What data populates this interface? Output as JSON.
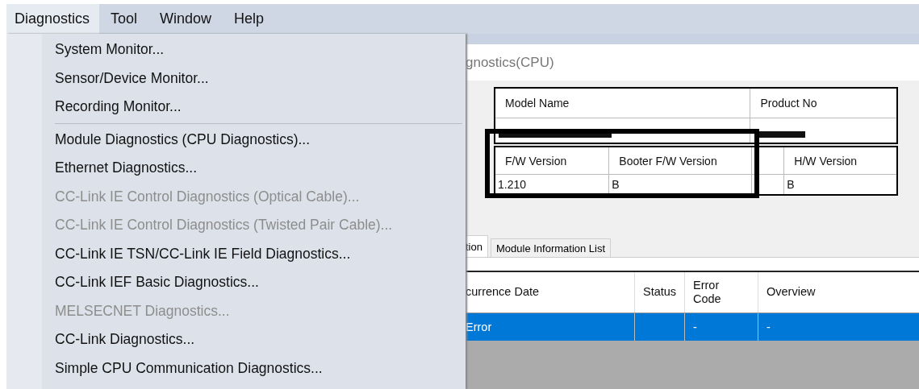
{
  "menu_bar": [
    {
      "label": "Diagnostics",
      "selected": true
    },
    {
      "label": "Tool",
      "selected": false
    },
    {
      "label": "Window",
      "selected": false
    },
    {
      "label": "Help",
      "selected": false
    }
  ],
  "dropdown": {
    "groups": [
      [
        {
          "label": "System Monitor...",
          "disabled": false
        },
        {
          "label": "Sensor/Device Monitor...",
          "disabled": false
        },
        {
          "label": "Recording Monitor...",
          "disabled": false
        }
      ],
      [
        {
          "label": "Module Diagnostics (CPU Diagnostics)...",
          "disabled": false
        },
        {
          "label": "Ethernet Diagnostics...",
          "disabled": false
        },
        {
          "label": "CC-Link IE Control Diagnostics (Optical Cable)...",
          "disabled": true
        },
        {
          "label": "CC-Link IE Control Diagnostics (Twisted Pair Cable)...",
          "disabled": true
        },
        {
          "label": "CC-Link IE TSN/CC-Link IE Field Diagnostics...",
          "disabled": false
        },
        {
          "label": "CC-Link IEF Basic Diagnostics...",
          "disabled": false
        },
        {
          "label": "MELSECNET Diagnostics...",
          "disabled": true
        },
        {
          "label": "CC-Link Diagnostics...",
          "disabled": false
        },
        {
          "label": "Simple CPU Communication Diagnostics...",
          "disabled": false
        }
      ]
    ]
  },
  "dialog": {
    "title": "gnostics(CPU)",
    "model_table": {
      "columns": [
        "Model Name",
        "Product No"
      ]
    },
    "version_table": {
      "columns": [
        {
          "kind": "field",
          "header": "F/W Version",
          "value": "1.210"
        },
        {
          "kind": "field",
          "header": "Booter F/W Version",
          "value": "B"
        },
        {
          "kind": "covered"
        },
        {
          "kind": "field",
          "header": "H/W Version",
          "value": "B"
        }
      ]
    },
    "tabs": [
      {
        "label": "tion",
        "selected": true
      },
      {
        "label": "Module Information List",
        "selected": false
      }
    ],
    "error_table": {
      "columns": [
        "currence Date",
        "Status",
        "Error\nCode",
        "Overview"
      ],
      "rows": [
        {
          "cells": [
            "Error",
            "",
            "-",
            "-"
          ],
          "selected": true
        }
      ]
    }
  }
}
